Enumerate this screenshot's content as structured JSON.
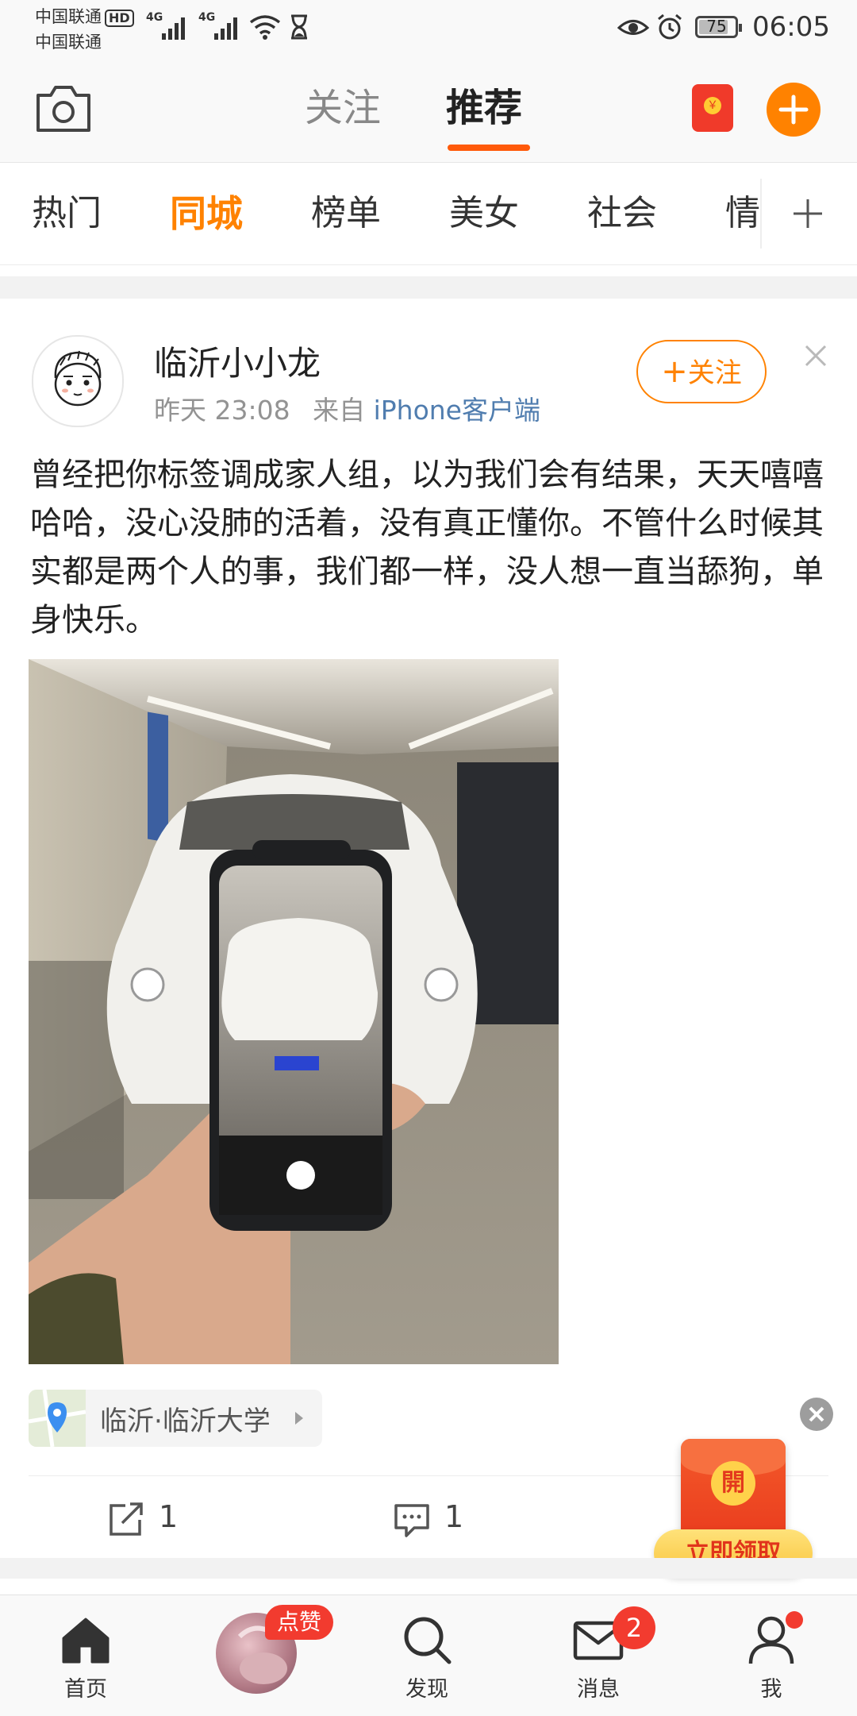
{
  "status_bar": {
    "carrier1": "中国联通",
    "carrier2": "中国联通",
    "hd": "HD",
    "net1": "4G",
    "net2": "4G",
    "battery": "75",
    "time": "06:05"
  },
  "header": {
    "tab_follow": "关注",
    "tab_recommend": "推荐",
    "red_packet_glyph": "￥"
  },
  "categories": [
    "热门",
    "同城",
    "榜单",
    "美女",
    "社会",
    "情"
  ],
  "post": {
    "username": "临沂小小龙",
    "time": "昨天 23:08",
    "source_prefix": "来自",
    "source": "iPhone客户端",
    "follow_label": "关注",
    "text": "曾经把你标签调成家人组，以为我们会有结果，天天嘻嘻哈哈，没心没肺的活着，没有真正懂你。不管什么时候其实都是两个人的事，我们都一样，没人想一直当舔狗，单身快乐。",
    "location": "临沂·临沂大学",
    "repost_count": "1",
    "comment_count": "1"
  },
  "promo": {
    "open_label": "開",
    "claim_label": "立即领取"
  },
  "bottom_nav": {
    "home": "首页",
    "like_badge": "点赞",
    "discover": "发现",
    "messages": "消息",
    "messages_badge": "2",
    "me": "我"
  },
  "colors": {
    "accent_orange": "#ff8200",
    "link_blue": "#507daf",
    "badge_red": "#f03434"
  }
}
